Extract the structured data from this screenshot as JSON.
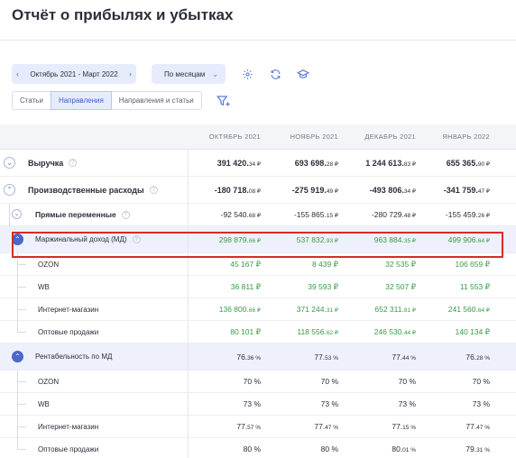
{
  "page": {
    "title": "Отчёт о прибылях и убытках"
  },
  "toolbar": {
    "period": "Октябрь 2021 - Март 2022",
    "group_by": "По месяцам",
    "tabs": [
      "Статьи",
      "Направления",
      "Направления и статьи"
    ],
    "active_tab": 1,
    "accent_color": "#4a67c9"
  },
  "table": {
    "columns": [
      "ОКТЯБРЬ 2021",
      "НОЯБРЬ 2021",
      "ДЕКАБРЬ 2021",
      "ЯНВАРЬ 2022"
    ],
    "rows": [
      {
        "label": "Выручка",
        "values": [
          [
            "391 420.",
            "34 ₽"
          ],
          [
            "693 698.",
            "28 ₽"
          ],
          [
            "1 244 613.",
            "83 ₽"
          ],
          [
            "655 365.",
            "90 ₽"
          ]
        ]
      },
      {
        "label": "Производственные расходы",
        "values": [
          [
            "-180 718.",
            "08 ₽"
          ],
          [
            "-275 919.",
            "49 ₽"
          ],
          [
            "-493 806.",
            "34 ₽"
          ],
          [
            "-341 759.",
            "47 ₽"
          ]
        ]
      },
      {
        "label": "Прямые переменные",
        "values": [
          [
            "-92 540.",
            "68 ₽"
          ],
          [
            "-155 865.",
            "15 ₽"
          ],
          [
            "-280 729.",
            "48 ₽"
          ],
          [
            "-155 459.",
            "26 ₽"
          ]
        ]
      },
      {
        "label": "Маржинальный доход (МД)",
        "values": [
          [
            "298 879.",
            "66 ₽"
          ],
          [
            "537 832.",
            "93 ₽"
          ],
          [
            "963 884.",
            "35 ₽"
          ],
          [
            "499 906.",
            "64 ₽"
          ]
        ]
      },
      {
        "label": "OZON",
        "values": [
          [
            "45 167 ₽",
            ""
          ],
          [
            "8 439 ₽",
            ""
          ],
          [
            "32 535 ₽",
            ""
          ],
          [
            "106 659 ₽",
            ""
          ]
        ]
      },
      {
        "label": "WB",
        "values": [
          [
            "36 811 ₽",
            ""
          ],
          [
            "39 593 ₽",
            ""
          ],
          [
            "32 507 ₽",
            ""
          ],
          [
            "11 553 ₽",
            ""
          ]
        ]
      },
      {
        "label": "Интернет-магазин",
        "values": [
          [
            "136 800.",
            "66 ₽"
          ],
          [
            "371 244.",
            "31 ₽"
          ],
          [
            "652 311.",
            "81 ₽"
          ],
          [
            "241 560.",
            "64 ₽"
          ]
        ]
      },
      {
        "label": "Оптовые продажи",
        "values": [
          [
            "80 101 ₽",
            ""
          ],
          [
            "118 556.",
            "62 ₽"
          ],
          [
            "246 530.",
            "44 ₽"
          ],
          [
            "140 134 ₽",
            ""
          ]
        ]
      },
      {
        "label": "Рентабельность по МД",
        "values": [
          [
            "76.",
            "36 %"
          ],
          [
            "77.",
            "53 %"
          ],
          [
            "77.",
            "44 %"
          ],
          [
            "76.",
            "28 %"
          ]
        ]
      },
      {
        "label": "OZON",
        "values": [
          [
            "70 %",
            ""
          ],
          [
            "70 %",
            ""
          ],
          [
            "70 %",
            ""
          ],
          [
            "70 %",
            ""
          ]
        ]
      },
      {
        "label": "WB",
        "values": [
          [
            "73 %",
            ""
          ],
          [
            "73 %",
            ""
          ],
          [
            "73 %",
            ""
          ],
          [
            "73 %",
            ""
          ]
        ]
      },
      {
        "label": "Интернет-магазин",
        "values": [
          [
            "77.",
            "57 %"
          ],
          [
            "77.",
            "47 %"
          ],
          [
            "77.",
            "15 %"
          ],
          [
            "77.",
            "47 %"
          ]
        ]
      },
      {
        "label": "Оптовые продажи",
        "values": [
          [
            "80 %",
            ""
          ],
          [
            "80 %",
            ""
          ],
          [
            "80.",
            "01 %"
          ],
          [
            "79.",
            "31 %"
          ]
        ]
      }
    ]
  },
  "colors": {
    "positive": "#3a9a47",
    "highlight_border": "#d62b2b",
    "row_shade": "#eef1fb"
  }
}
